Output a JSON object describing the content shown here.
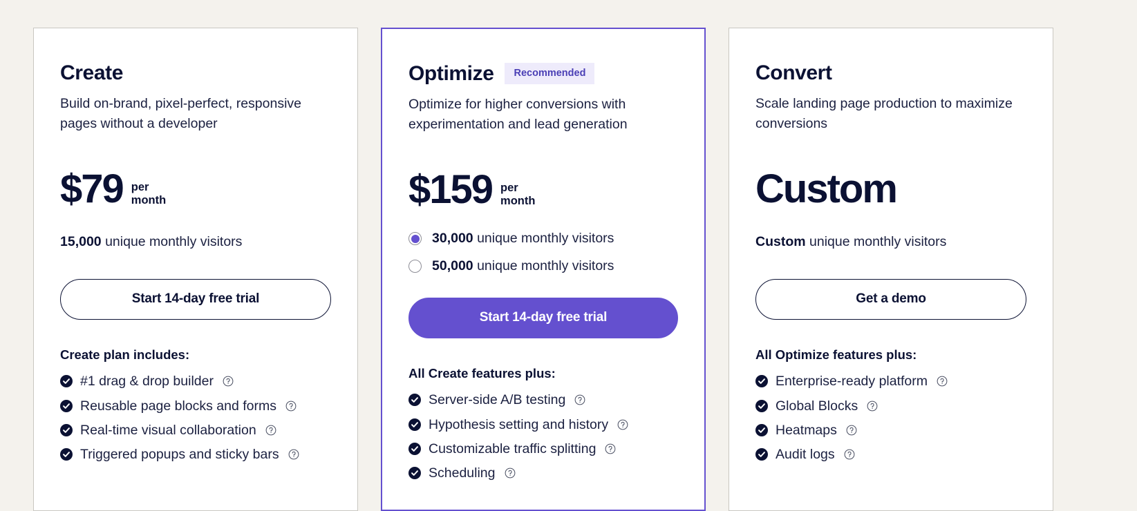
{
  "plans": [
    {
      "name": "Create",
      "badge": null,
      "description": "Build on-brand, pixel-perfect, responsive pages without a developer",
      "price": "$79",
      "period_line1": "per",
      "period_line2": "month",
      "visitors_value": "15,000",
      "visitors_label": "unique monthly visitors",
      "options": [],
      "cta": "Start 14-day free trial",
      "cta_style": "outline",
      "features_title": "Create plan includes:",
      "features": [
        "#1 drag & drop builder",
        "Reusable page blocks and forms",
        "Real-time visual collaboration",
        "Triggered popups and sticky bars"
      ]
    },
    {
      "name": "Optimize",
      "badge": "Recommended",
      "description": "Optimize for higher conversions with experimentation and lead generation",
      "price": "$159",
      "period_line1": "per",
      "period_line2": "month",
      "visitors_value": null,
      "visitors_label": null,
      "options": [
        {
          "value": "30,000",
          "label": "unique monthly visitors",
          "selected": true
        },
        {
          "value": "50,000",
          "label": "unique monthly visitors",
          "selected": false
        }
      ],
      "cta": "Start 14-day free trial",
      "cta_style": "primary",
      "features_title": "All Create features plus:",
      "features": [
        "Server-side A/B testing",
        "Hypothesis setting and history",
        "Customizable traffic splitting",
        "Scheduling"
      ]
    },
    {
      "name": "Convert",
      "badge": null,
      "description": "Scale landing page production to maximize conversions",
      "price": "Custom",
      "period_line1": "",
      "period_line2": "",
      "visitors_value": "Custom",
      "visitors_label": "unique monthly visitors",
      "options": [],
      "cta": "Get a demo",
      "cta_style": "outline",
      "features_title": "All Optimize features plus:",
      "features": [
        "Enterprise-ready platform",
        "Global Blocks",
        "Heatmaps",
        "Audit logs"
      ]
    }
  ],
  "colors": {
    "page_background": "#f4f2ed",
    "card_background": "#ffffff",
    "accent_purple": "#6450cf",
    "badge_background": "#eeebfb",
    "badge_text": "#4a3fb5",
    "text_dark": "#0b1133"
  },
  "icons": {
    "check": "check-circle-icon",
    "help": "help-circle-icon"
  }
}
